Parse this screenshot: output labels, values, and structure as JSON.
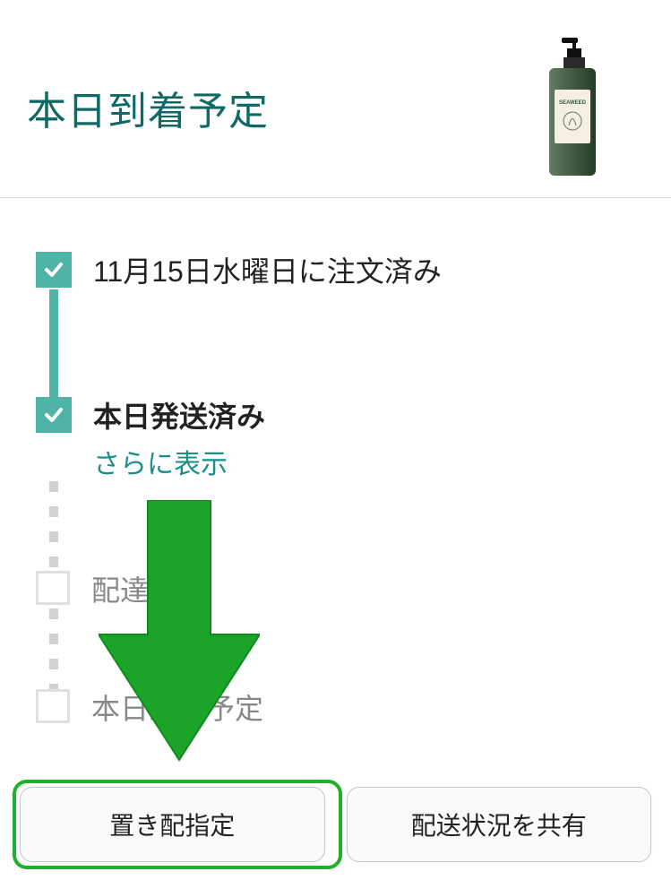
{
  "header": {
    "title": "本日到着予定",
    "product_name": "SEAWEED"
  },
  "timeline": {
    "steps": [
      {
        "title": "11月15日水曜日に注文済み",
        "status": "done"
      },
      {
        "title": "本日発送済み",
        "status": "done",
        "link": "さらに表示"
      },
      {
        "title": "配達中",
        "status": "pending"
      },
      {
        "title": "本日到着予定",
        "status": "pending"
      }
    ]
  },
  "actions": {
    "leave_at_door": "置き配指定",
    "share_status": "配送状況を共有"
  },
  "colors": {
    "accent": "#4fb3a6",
    "highlight": "#1fb02c",
    "arrow": "#22a52e"
  }
}
